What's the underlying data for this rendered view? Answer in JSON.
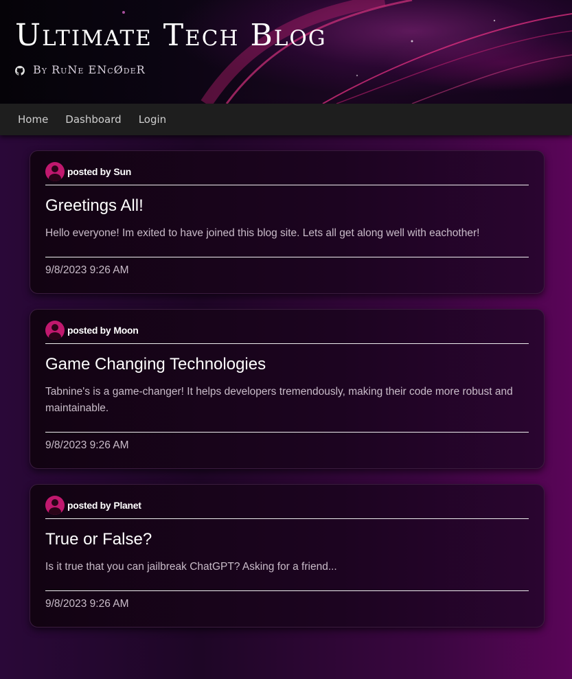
{
  "header": {
    "title": "Ultimate Tech Blog",
    "byline": "By RuNe ENcØdeR",
    "byline_icon": "github-icon"
  },
  "nav": {
    "items": [
      {
        "label": "Home"
      },
      {
        "label": "Dashboard"
      },
      {
        "label": "Login"
      }
    ]
  },
  "colors": {
    "accent": "#c0186e",
    "nav_bg": "#1e1e1e"
  },
  "posts": [
    {
      "author_prefix": "posted by",
      "author": "Sun",
      "title": "Greetings All!",
      "body": "Hello everyone! Im exited to have joined this blog site. Lets all get along well with eachother!",
      "date": "9/8/2023 9:26 AM"
    },
    {
      "author_prefix": "posted by",
      "author": "Moon",
      "title": "Game Changing Technologies",
      "body": "Tabnine's is a game-changer! It helps developers tremendously, making their code more robust and maintainable.",
      "date": "9/8/2023 9:26 AM"
    },
    {
      "author_prefix": "posted by",
      "author": "Planet",
      "title": "True or False?",
      "body": "Is it true that you can jailbreak ChatGPT? Asking for a friend...",
      "date": "9/8/2023 9:26 AM"
    }
  ]
}
